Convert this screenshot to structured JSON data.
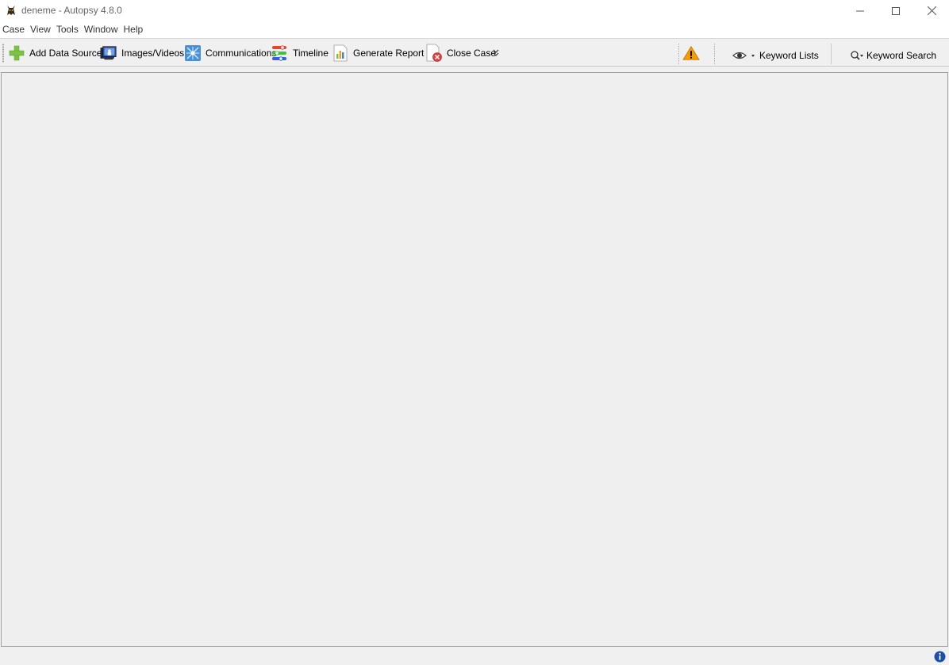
{
  "window": {
    "title": "deneme - Autopsy 4.8.0",
    "app_icon": "autopsy-dog-icon",
    "controls": [
      "minimize-icon",
      "maximize-icon",
      "close-icon"
    ]
  },
  "menu": {
    "items": [
      "Case",
      "View",
      "Tools",
      "Window",
      "Help"
    ]
  },
  "toolbar": {
    "add_data_source": "Add Data Source",
    "images_videos": "Images/Videos",
    "communications": "Communications",
    "timeline": "Timeline",
    "generate_report": "Generate Report",
    "close_case": "Close Case",
    "keyword_lists": "Keyword Lists",
    "keyword_search": "Keyword Search",
    "icons": {
      "add_data_source": "plus-icon",
      "images_videos": "monitor-photo-icon",
      "communications": "communications-icon",
      "timeline": "timeline-icon",
      "generate_report": "report-chart-icon",
      "close_case": "close-case-icon",
      "more": "double-chevron-down-icon",
      "warning": "warning-icon",
      "keyword_lists": "eye-icon",
      "keyword_search": "magnifier-icon"
    }
  },
  "statusbar": {
    "info_icon": "info-icon"
  },
  "colors": {
    "accent_green": "#7cc242",
    "warning_orange": "#f59b00",
    "info_blue": "#1e4fa8",
    "background": "#f0f0f0"
  }
}
